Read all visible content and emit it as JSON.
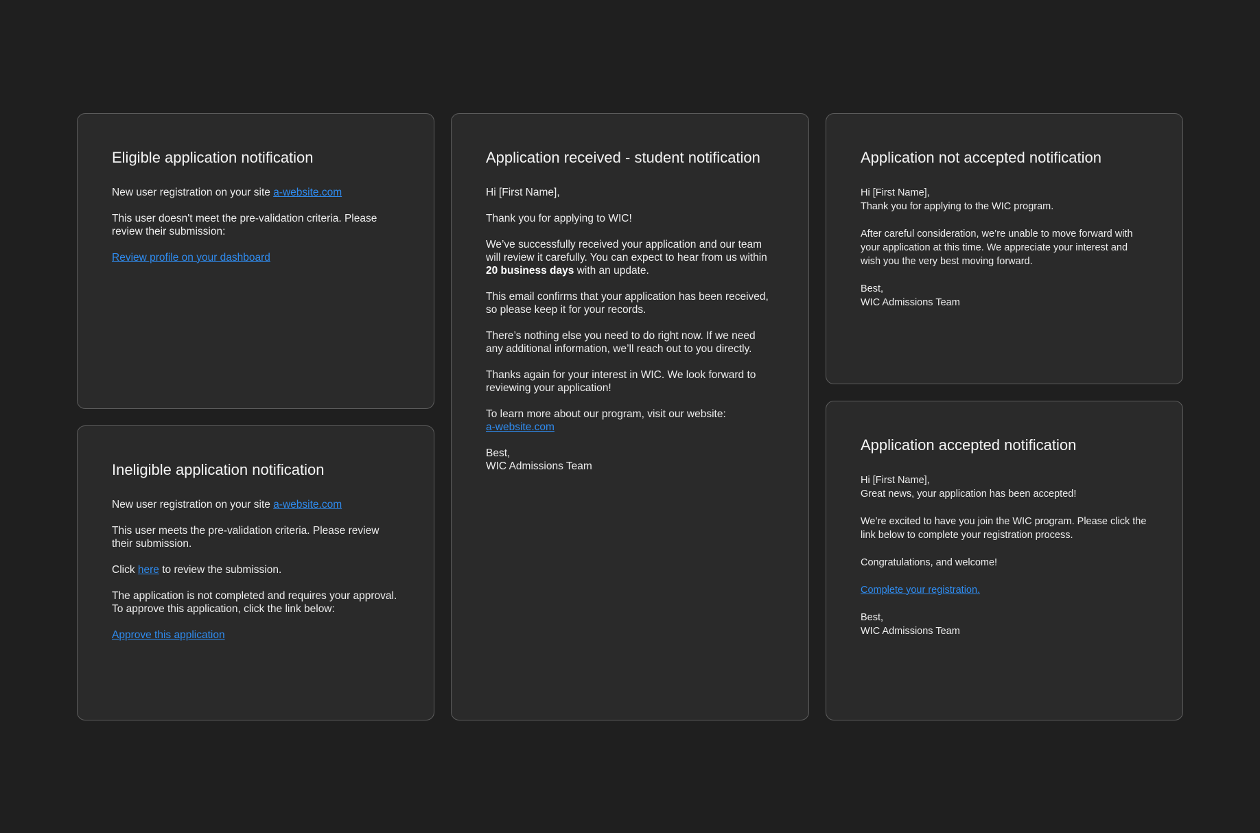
{
  "eligible": {
    "title": "Eligible application notification",
    "p1_text": "New user registration on your site ",
    "p1_link": "a-website.com",
    "p2": "This user doesn't meet the pre-validation criteria. Please review their submission:",
    "review_link": "Review profile on your dashboard"
  },
  "ineligible": {
    "title": "Ineligible application notification",
    "p1_text": "New user registration on your site ",
    "p1_link": "a-website.com",
    "p2": "This user meets the pre-validation criteria. Please review their submission.",
    "click_prefix": "Click ",
    "click_link": "here",
    "click_suffix": " to review the submission.",
    "p4_line1": "The application is not completed and requires your approval.",
    "p4_line2": "To approve this application, click the link below:",
    "approve_link": "Approve this application"
  },
  "received": {
    "title": "Application received - student notification",
    "greeting": "Hi [First Name],",
    "thanks": "Thank you for applying to WIC!",
    "p3_text": "We’ve successfully received your application and our team will review it carefully. You can expect to hear from us within ",
    "p3_bold": "20 business days",
    "p3_suffix": " with an update.",
    "p4": "This email confirms that your application has been received, so please keep it for your records.",
    "p5": "There’s nothing else you need to do right now. If we need any additional information, we’ll reach out to you directly.",
    "p6": "Thanks again for your interest in WIC. We look forward to reviewing your application!",
    "p7_text": "To learn more about our program, visit our website:",
    "p7_link": "a-website.com",
    "signoff": "Best,",
    "signature": "WIC Admissions Team"
  },
  "not_accepted": {
    "title": "Application not accepted notification",
    "greeting": "Hi [First Name],",
    "line2": "Thank you for applying to the WIC program.",
    "p2": "After careful consideration, we’re unable to move forward with your application at this time. We appreciate your interest and wish you the very best moving forward.",
    "signoff": "Best,",
    "signature": "WIC Admissions Team"
  },
  "accepted": {
    "title": "Application accepted notification",
    "greeting": "Hi [First Name],",
    "line2": "Great news, your application has been accepted!",
    "p2": "We’re excited to have you join the WIC program. Please click the link below to complete your registration process.",
    "p3": "Congratulations, and welcome!",
    "registration_link": "Complete your registration.",
    "signoff": "Best,",
    "signature": "WIC Admissions Team"
  },
  "colors": {
    "background": "#1f1f1f",
    "card": "#2a2a2a",
    "border": "#5c5c5c",
    "link": "#2f8cf0"
  }
}
